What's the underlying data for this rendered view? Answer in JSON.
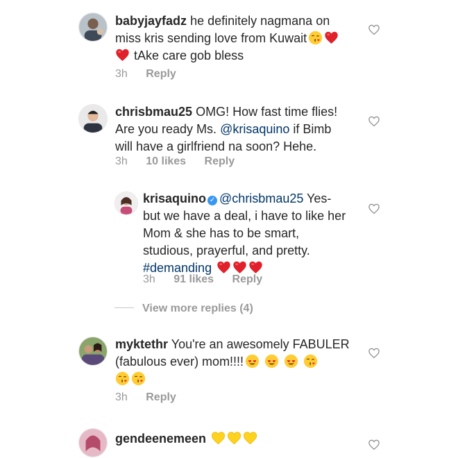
{
  "colors": {
    "text": "#262626",
    "meta": "#999999",
    "link": "#003569",
    "verified": "#3897f0"
  },
  "comments": [
    {
      "username": "babyjayfadz",
      "lines": [
        "he definitely nagmana on",
        "miss kris sending love from Kuwait",
        "tAke care gob bless"
      ],
      "time": "3h",
      "reply": "Reply"
    },
    {
      "username": "chrisbmau25",
      "text1": "OMG! How fast time flies!",
      "text2a": "Are you ready Ms. ",
      "mention": "@krisaquino",
      "text2b": " if Bimb",
      "text3": "will have a girlfriend na soon? Hehe.",
      "time": "3h",
      "likes": "10 likes",
      "reply": "Reply"
    },
    {
      "username": "krisaquino",
      "mention": "@chrisbmau25",
      "text1b": " Yes-",
      "text2": "but we have a deal, i have to like her",
      "text3": "Mom & she has to be smart,",
      "text4": "studious, prayerful, and pretty.",
      "hashtag": "#demanding",
      "time": "3h",
      "likes": "91 likes",
      "reply": "Reply"
    },
    {
      "username": "myktethr",
      "text1": "You're an awesomely FABULER",
      "text2": "(fabulous ever) mom!!!!",
      "time": "3h",
      "reply": "Reply"
    },
    {
      "username": "gendeenemeen"
    }
  ],
  "view_more": "View more replies (4)",
  "icons": [
    "heart-outline-icon",
    "verified-badge-icon",
    "red-heart-emoji",
    "kiss-emoji",
    "heart-eyes-emoji",
    "yellow-heart-emoji"
  ]
}
